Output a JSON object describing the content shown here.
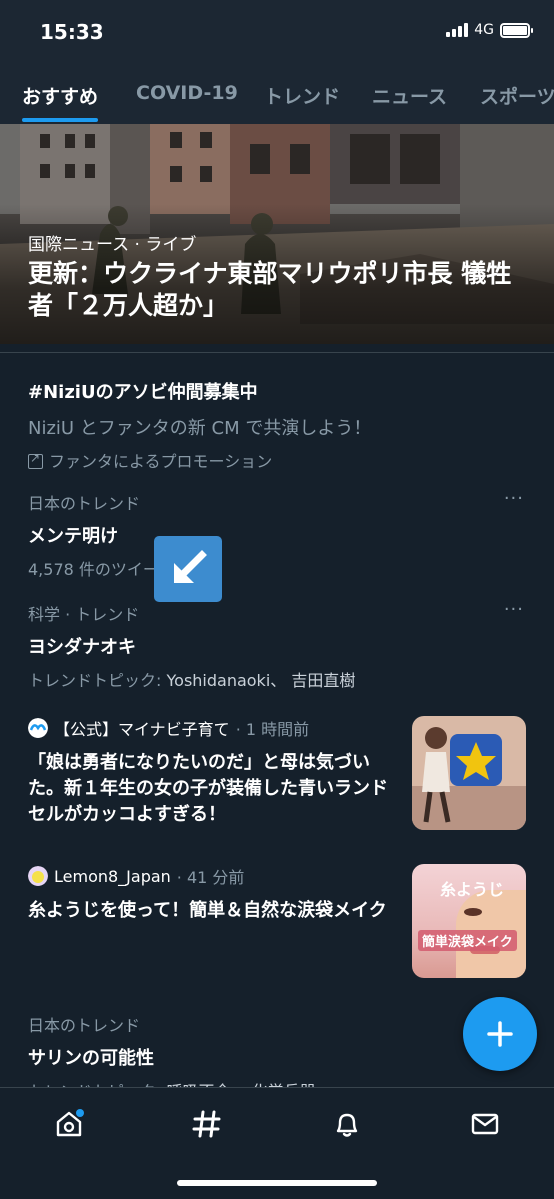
{
  "status": {
    "time": "15:33",
    "network": "4G"
  },
  "tabs": [
    {
      "label": "おすすめ",
      "active": true
    },
    {
      "label": "COVID-19"
    },
    {
      "label": "トレンド"
    },
    {
      "label": "ニュース"
    },
    {
      "label": "スポーツ"
    }
  ],
  "hero": {
    "category": "国際ニュース · ライブ",
    "title": "更新：ウクライナ東部マリウポリ市長 犠牲者「２万人超か」"
  },
  "promo": {
    "title": "#NiziUのアソビ仲間募集中",
    "description": "NiziU とファンタの新 CM で共演しよう！",
    "promoted_by": "ファンタによるプロモーション"
  },
  "trends": [
    {
      "context": "日本のトレンド",
      "title": "メンテ明け",
      "meta": "4,578 件のツイート",
      "more": "···"
    },
    {
      "context": "科学 · トレンド",
      "title": "ヨシダナオキ",
      "meta_label": "トレンドトピック:",
      "meta_value": "Yoshidanaoki、 吉田直樹",
      "more": "···"
    }
  ],
  "news": [
    {
      "source": "【公式】マイナビ子育て",
      "time": "· 1 時間前",
      "text": "「娘は勇者になりたいのだ」と母は気づいた。新１年生の女の子が装備した青いランドセルがカッコよすぎる！"
    },
    {
      "source": "Lemon8_Japan",
      "time": "· 41 分前",
      "text": "糸ようじを使って！簡単＆自然な涙袋メイク",
      "thumb_caption_top": "糸ようじ",
      "thumb_caption_bottom": "簡単涙袋メイク"
    }
  ],
  "last_trend": {
    "context": "日本のトレンド",
    "title": "サリンの可能性",
    "meta_label": "トレンドトピック:",
    "meta_value": "呼吸不全、 化学兵器"
  },
  "colors": {
    "accent": "#1d9bf0",
    "background": "#15202b",
    "muted": "#8899a6"
  },
  "icons": [
    "home-icon",
    "explore-hashtag-icon",
    "notifications-bell-icon",
    "messages-envelope-icon",
    "compose-plus-icon"
  ]
}
